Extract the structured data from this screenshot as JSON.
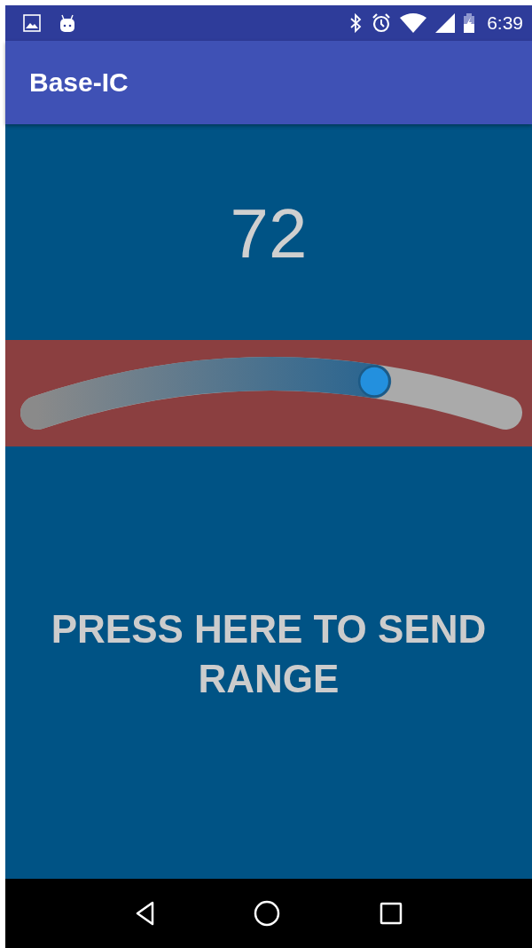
{
  "status_bar": {
    "time": "6:39"
  },
  "app_bar": {
    "title": "Base-IC"
  },
  "reading": "72",
  "slider": {
    "level": 0.72
  },
  "send_button": {
    "label": "PRESS HERE TO SEND RANGE"
  }
}
